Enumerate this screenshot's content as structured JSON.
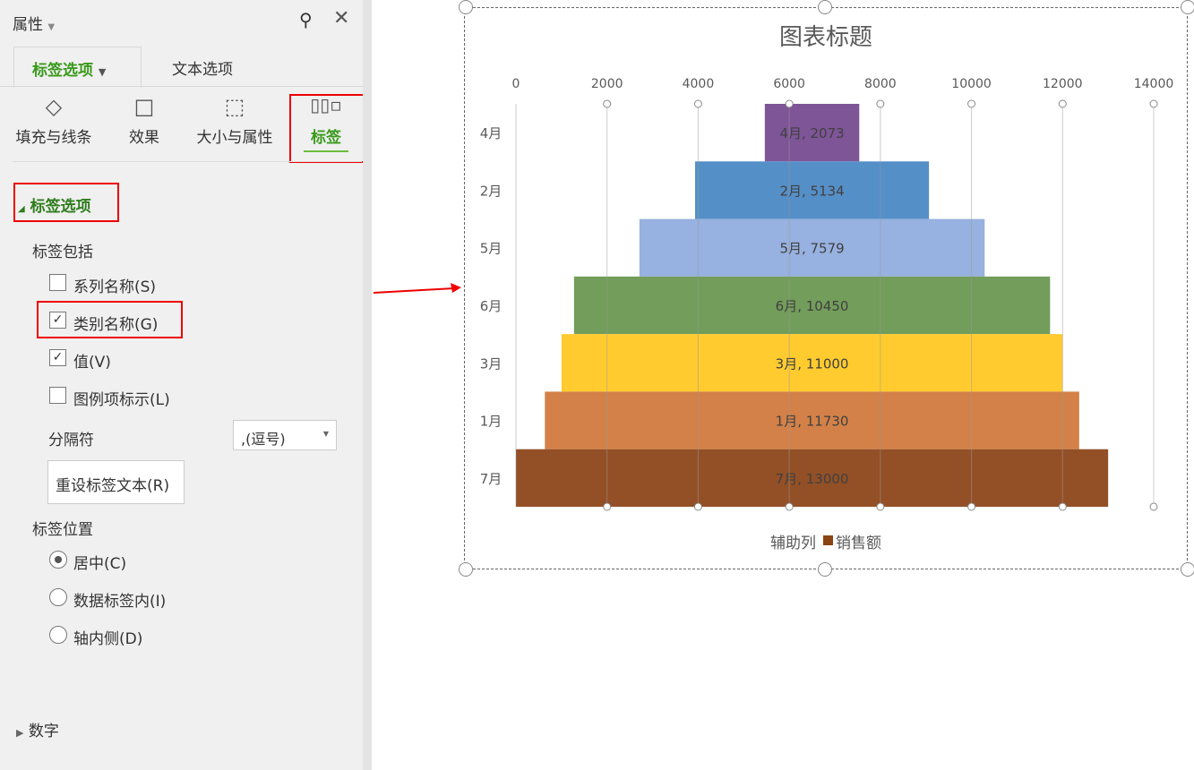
{
  "panel": {
    "title": "属性",
    "tabs": [
      "标签选项",
      "文本选项"
    ],
    "icon_tabs": [
      {
        "label": "填充与线条",
        "icon": "fill-line-icon"
      },
      {
        "label": "效果",
        "icon": "effects-icon"
      },
      {
        "label": "大小与属性",
        "icon": "size-properties-icon"
      },
      {
        "label": "标签",
        "icon": "label-icon"
      }
    ],
    "section": "标签选项",
    "include_label": "标签包括",
    "checks": [
      {
        "label": "系列名称(S)",
        "checked": false
      },
      {
        "label": "类别名称(G)",
        "checked": true
      },
      {
        "label": "值(V)",
        "checked": true
      },
      {
        "label": "图例项标示(L)",
        "checked": false
      }
    ],
    "separator_label": "分隔符",
    "separator_value": ",(逗号)",
    "reset_button": "重设标签文本(R)",
    "position_label": "标签位置",
    "positions": [
      {
        "label": "居中(C)",
        "selected": true
      },
      {
        "label": "数据标签内(I)",
        "selected": false
      },
      {
        "label": "轴内侧(D)",
        "selected": false
      }
    ],
    "number_section": "数字",
    "accent": "#3a9a1c"
  },
  "chart_data": {
    "type": "bar",
    "title": "图表标题",
    "categories": [
      "4月",
      "2月",
      "5月",
      "6月",
      "3月",
      "1月",
      "7月"
    ],
    "values": [
      2073,
      5134,
      7579,
      10450,
      11000,
      11730,
      13000
    ],
    "labels": [
      "4月, 2073",
      "2月, 5134",
      "5月, 7579",
      "6月, 10450",
      "3月, 11000",
      "1月, 11730",
      "7月, 13000"
    ],
    "colors": [
      "#7a4f94",
      "#4f8bc6",
      "#94aedf",
      "#6e9a55",
      "#ffc928",
      "#d27d42",
      "#8f4a1f"
    ],
    "xticks": [
      "0",
      "2000",
      "4000",
      "6000",
      "8000",
      "10000",
      "12000",
      "14000"
    ],
    "xlim": [
      0,
      14000
    ],
    "center": 6500,
    "legend": [
      {
        "name": "辅助列",
        "color": "none"
      },
      {
        "name": "销售额",
        "color": "#8b4513"
      }
    ],
    "legend_position": "bottom"
  }
}
